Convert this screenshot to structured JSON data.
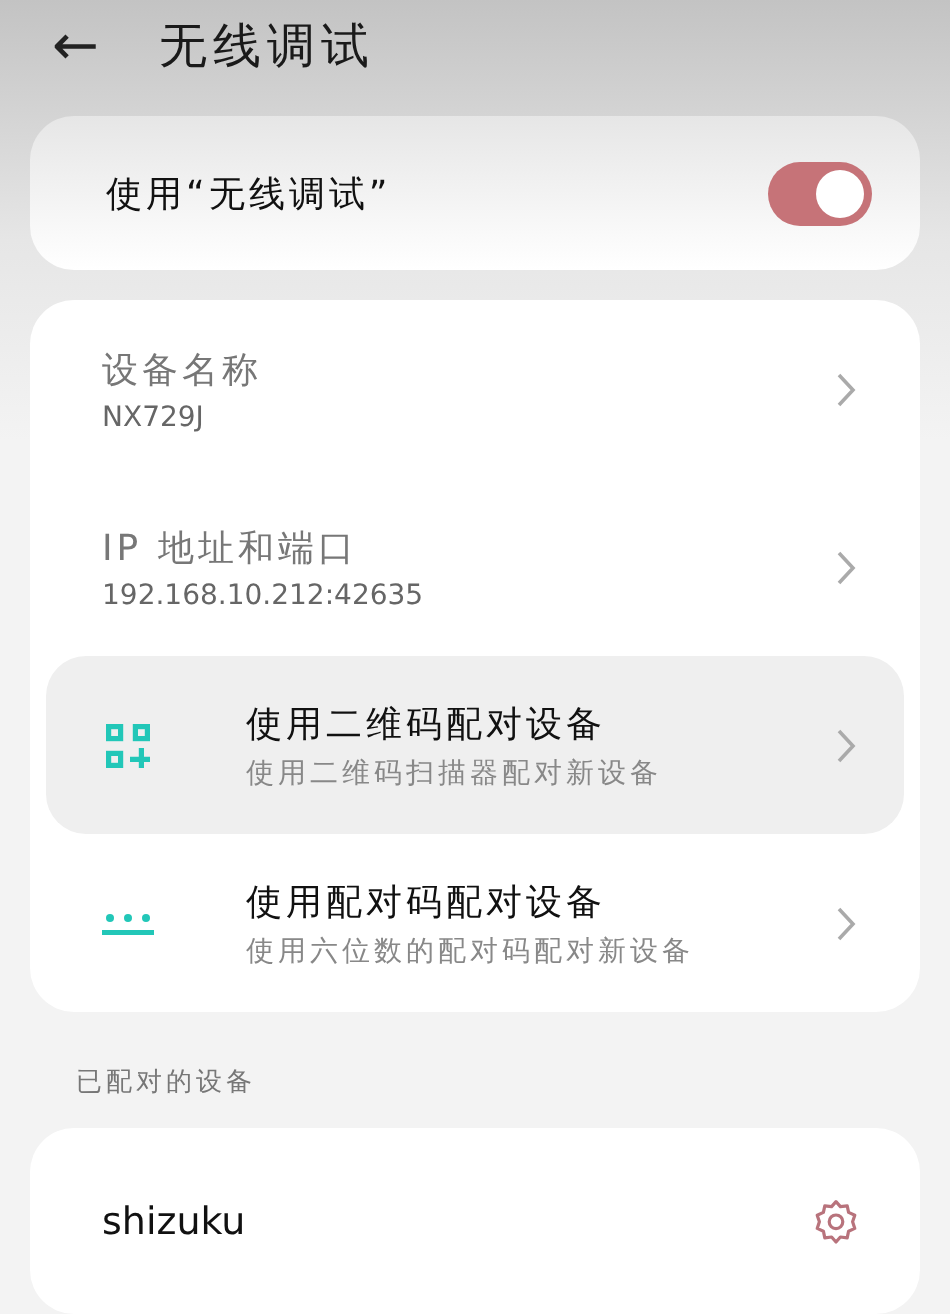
{
  "header": {
    "back": "←",
    "title": "无线调试"
  },
  "toggle": {
    "label": "使用“无线调试”",
    "on": true
  },
  "items": [
    {
      "kind": "info",
      "title": "设备名称",
      "value": "NX729J",
      "highlighted": false
    },
    {
      "kind": "info",
      "title": "IP 地址和端口",
      "value": "192.168.10.212:42635",
      "highlighted": false
    },
    {
      "kind": "qr",
      "title": "使用二维码配对设备",
      "value": "使用二维码扫描器配对新设备",
      "highlighted": true
    },
    {
      "kind": "code",
      "title": "使用配对码配对设备",
      "value": "使用六位数的配对码配对新设备",
      "highlighted": false
    }
  ],
  "paired_section": {
    "label": "已配对的设备",
    "devices": [
      {
        "name": "shizuku"
      }
    ]
  }
}
